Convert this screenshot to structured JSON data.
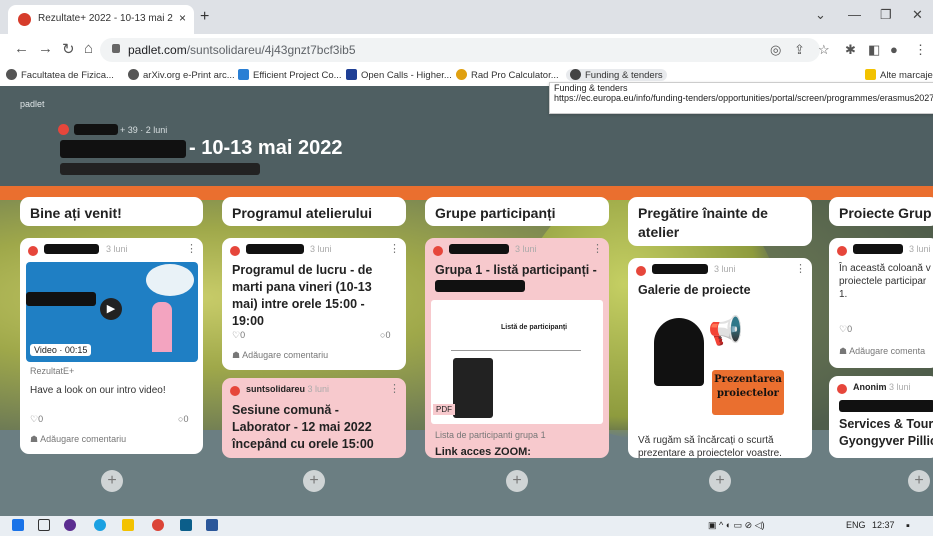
{
  "browser": {
    "tab_title": "Rezultate+ 2022 - 10-13 mai 202",
    "tab_close": "×",
    "new_tab": "+",
    "url_host": "padlet.com",
    "url_path": "/suntsolidareu/4j43gnzt7bcf3ib5",
    "bookmarks": [
      {
        "label": "Facultatea de Fizica...",
        "color": "#555555"
      },
      {
        "label": "arXiv.org e-Print arc...",
        "color": "#555555"
      },
      {
        "label": "Efficient Project Co...",
        "color": "#2a7fd4"
      },
      {
        "label": "Open Calls - Higher...",
        "color": "#1f3f95"
      },
      {
        "label": "Rad Pro Calculator...",
        "color": "#e0a010"
      },
      {
        "label": "Funding & tenders",
        "color": "#444444"
      },
      {
        "label": "Alte marcaje",
        "color": "#f2c200"
      }
    ],
    "tooltip_title": "Funding & tenders",
    "tooltip_url": "https://ec.europa.eu/info/funding-tenders/opportunities/portal/screen/programmes/erasmus2027"
  },
  "padlet": {
    "brand": "padlet",
    "meta": "+ 39 · 2 luni",
    "title": "- 10-13 mai 2022",
    "columns": [
      {
        "title": "Bine ați venit!"
      },
      {
        "title": "Programul atelierului"
      },
      {
        "title": "Grupe participanți"
      },
      {
        "title": "Pregătire înainte de atelier"
      },
      {
        "title": "Proiecte Grup"
      }
    ],
    "cards": {
      "c1": {
        "time": "3 luni",
        "video_badge": "Video · 00:15",
        "source": "RezultatE+",
        "body": "Have a look on our intro video!",
        "likes": "0",
        "comments": "0",
        "add_comment": "Adăugare comentariu"
      },
      "c2": {
        "time": "3 luni",
        "subject": "Programul de lucru - de marti pana vineri (10-13 mai) intre orele 15:00 - 19:00",
        "likes": "0",
        "comments": "0",
        "add_comment": "Adăugare comentariu"
      },
      "c3": {
        "author": "suntsolidareu",
        "time": "3 luni",
        "subject": "Sesiune comună - Laborator - 12 mai 2022 începând cu orele 15:00"
      },
      "c4": {
        "time": "3 luni",
        "subject": "Grupa 1 - listă participanți -",
        "pdf_badge": "PDF",
        "doc_title": "Listă de participanți",
        "caption": "Lista de participanti grupa 1",
        "link_title": "Link acces ZOOM:"
      },
      "c5": {
        "time": "3 luni",
        "subject": "Galerie de proiecte",
        "poster_text": "Prezentarea proiectelor",
        "body": "Vă rugăm să încărcați o scurtă prezentare a proiectelor voastre."
      },
      "c6": {
        "time": "3 luni",
        "body": "În această coloană v proiectele participar 1.",
        "likes": "0",
        "add_comment": "Adăugare comenta"
      },
      "c7": {
        "author": "Anonim",
        "time": "3 luni",
        "subject": "Services & Touri Gyongyver Pillich"
      }
    },
    "add_symbol": "+"
  },
  "taskbar": {
    "lang": "ENG",
    "time": "12:37"
  }
}
